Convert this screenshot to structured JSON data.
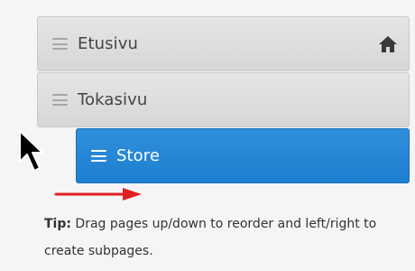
{
  "pages": [
    {
      "label": "Etusivu",
      "is_home": true,
      "level": 0,
      "state": "normal"
    },
    {
      "label": "Tokasivu",
      "is_home": false,
      "level": 0,
      "state": "normal"
    },
    {
      "label": "Store",
      "is_home": false,
      "level": 1,
      "state": "dragging"
    }
  ],
  "icons": {
    "handle": "drag-handle-icon",
    "home": "home-icon",
    "cursor": "mouse-pointer-icon",
    "arrow": "arrow-right-icon"
  },
  "tip": {
    "label": "Tip:",
    "text": "Drag pages up/down to reorder and left/right to create subpages."
  },
  "colors": {
    "row_gray": "#dedede",
    "row_selected": "#2585d4",
    "arrow": "#e02020",
    "text": "#333333"
  }
}
